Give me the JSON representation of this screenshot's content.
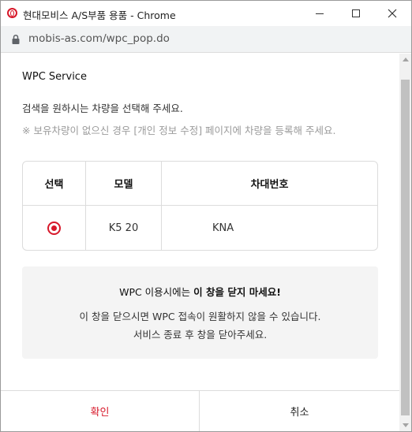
{
  "window": {
    "title": "현대모비스 A/S부품 용품 - Chrome",
    "url": "mobis-as.com/wpc_pop.do"
  },
  "icons": {
    "app": "hyundai-mobis-logo-icon",
    "minimize": "minimize-icon",
    "maximize": "maximize-icon",
    "close": "close-icon",
    "lock": "lock-icon"
  },
  "colors": {
    "accent": "#d7182a",
    "hint_text": "#9a9a9a",
    "notice_bg": "#f4f4f4"
  },
  "page": {
    "service_title": "WPC Service",
    "instruction": "검색을 원하시는 차량을 선택해 주세요.",
    "hint": "※ 보유차량이 없으신 경우 [개인 정보 수정] 페이지에 차량을 등록해 주세요."
  },
  "vehicle_table": {
    "headers": [
      "선택",
      "모델",
      "차대번호"
    ],
    "rows": [
      {
        "selected": true,
        "model": "K5 20",
        "vin": "KNA"
      }
    ]
  },
  "notice": {
    "title_prefix": "WPC 이용시에는 ",
    "title_bold": "이 창을 닫지 마세요!",
    "line1": "이 창을 닫으시면 WPC 접속이 원활하지 않을 수 있습니다.",
    "line2": "서비스 종료 후 창을 닫아주세요."
  },
  "buttons": {
    "confirm": "확인",
    "cancel": "취소"
  }
}
